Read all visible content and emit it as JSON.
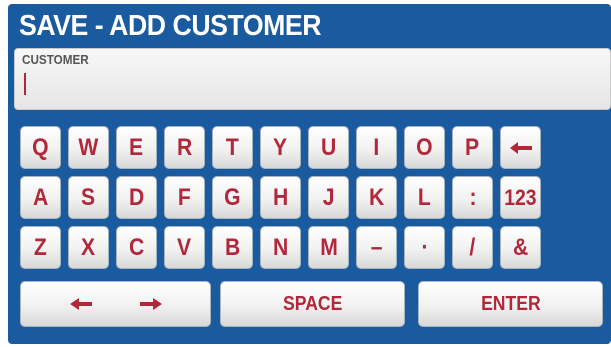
{
  "title": "SAVE - ADD CUSTOMER",
  "customer_field": {
    "label": "CUSTOMER",
    "value": ""
  },
  "keyboard": {
    "row1": [
      "Q",
      "W",
      "E",
      "R",
      "T",
      "Y",
      "U",
      "I",
      "O",
      "P"
    ],
    "row2": [
      "A",
      "S",
      "D",
      "F",
      "G",
      "H",
      "J",
      "K",
      "L",
      ":",
      "123"
    ],
    "row3": [
      "Z",
      "X",
      "C",
      "V",
      "B",
      "N",
      "M",
      "–",
      "·",
      "/",
      "&"
    ],
    "backspace_icon": "left-arrow-backspace-icon",
    "arrow_keys": {
      "left_icon": "arrow-left-icon",
      "right_icon": "arrow-right-icon"
    },
    "space_label": "SPACE",
    "enter_label": "ENTER"
  },
  "colors": {
    "frame_blue": "#1a5a9e",
    "key_text_red": "#b0283a",
    "key_face": "#f1f1f1"
  }
}
